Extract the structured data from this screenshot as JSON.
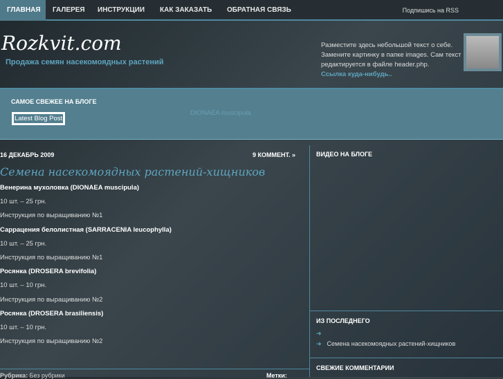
{
  "nav": {
    "items": [
      "ГЛАВНАЯ",
      "ГАЛЕРЕЯ",
      "ИНСТРУКЦИИ",
      "КАК ЗАКАЗАТЬ",
      "ОБРАТНАЯ СВЯЗЬ"
    ],
    "rss": "Подпишись на RSS"
  },
  "header": {
    "logo": "Rozkvit.com",
    "tagline": "Продажа семян насекомоядных растений",
    "about": "Разместите здесь небольшой текст о себе. Замените картинку в папке images. Сам текст редактируется в файле header.php.",
    "about_link": "Ссылка куда-нибудь.."
  },
  "featured": {
    "title": "САМОЕ СВЕЖЕЕ НА БЛОГЕ",
    "button": "Latest Blog Post",
    "link": "DIONAEA muscipula"
  },
  "post": {
    "date": "16 ДЕКАБРЬ 2009",
    "comments": "9 КОММЕНТ. »",
    "title": "Семена насекомоядных растений-хищников",
    "lines": [
      {
        "t": "Венерина мухоловка (DIONAEA muscipula)",
        "b": true
      },
      {
        "t": "10 шт. – 25 грн."
      },
      {
        "t": "Инструкция по выращиванию №1"
      },
      {
        "t": "Саррацения белолистная (SARRACENIA leucophylla)",
        "b": true
      },
      {
        "t": "10 шт. – 25 грн."
      },
      {
        "t": "Инструкция по выращиванию №1"
      },
      {
        "t": "Росянка (DROSERA brevifolia)",
        "b": true
      },
      {
        "t": "10 шт. – 10 грн."
      },
      {
        "t": "Инструкция по выращиванию №2"
      },
      {
        "t": "Росянка (DROSERA brasiliensis)",
        "b": true
      },
      {
        "t": "10 шт. – 10 грн."
      },
      {
        "t": "Инструкция по выращиванию №2"
      }
    ],
    "category_label": "Рубрика:",
    "category": "Без рубрики",
    "tags_label": "Метки:"
  },
  "sidebar": {
    "video": "ВИДЕО НА БЛОГЕ",
    "recent": "ИЗ ПОСЛЕДНЕГО",
    "recent_items": [
      "",
      "Семена насекомоядных растений-хищников"
    ],
    "comments": "СВЕЖИЕ КОММЕНТАРИИ"
  },
  "colors": {
    "accent": "#5fa5bf",
    "band": "#537f8f"
  }
}
